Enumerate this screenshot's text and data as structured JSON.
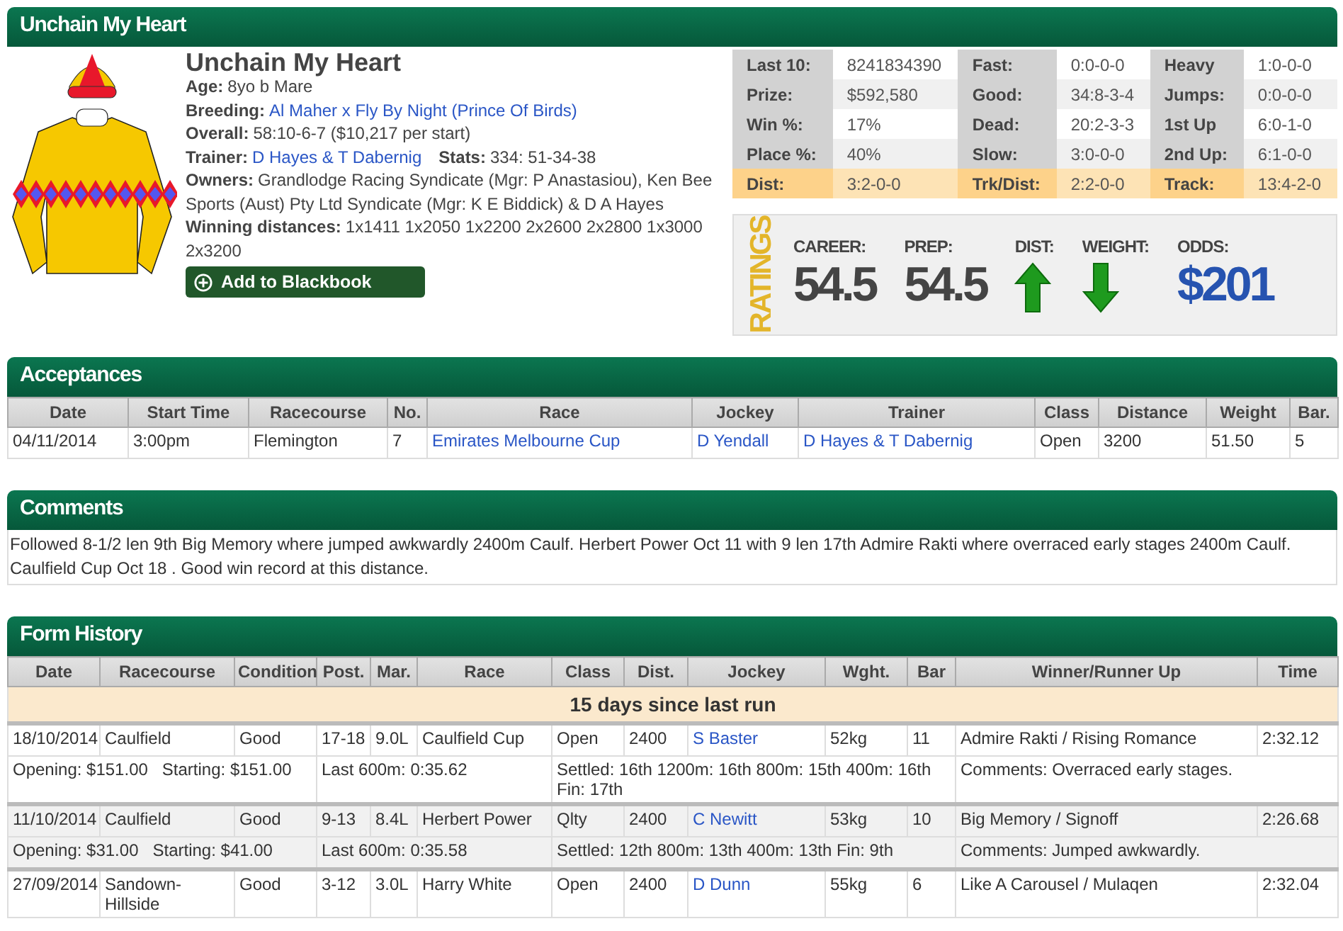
{
  "profile": {
    "title": "Unchain My Heart",
    "name": "Unchain My Heart",
    "info": [
      {
        "pairs": [
          {
            "label": "Age:",
            "value": "8yo b Mare",
            "link": false
          }
        ]
      },
      {
        "pairs": [
          {
            "label": "Breeding:",
            "value": "Al Maher x Fly By Night (Prince Of Birds)",
            "link": true
          }
        ]
      },
      {
        "pairs": [
          {
            "label": "Overall:",
            "value": "58:10-6-7 ($10,217 per start)",
            "link": false
          }
        ]
      },
      {
        "pairs": [
          {
            "label": "Trainer:",
            "value": "D Hayes & T Dabernig",
            "link": true
          },
          {
            "label": "Stats:",
            "value": "334: 51-34-38",
            "link": false
          }
        ]
      },
      {
        "pairs": [
          {
            "label": "Owners:",
            "value": "Grandlodge Racing Syndicate (Mgr: P Anastasiou), Ken Bee Sports (Aust) Pty Ltd Syndicate (Mgr: K E Biddick) & D A Hayes",
            "link": false
          }
        ]
      },
      {
        "pairs": [
          {
            "label": "Winning distances:",
            "value": "1x1411 1x2050 1x2200 2x2600 2x2800 1x3000 2x3200",
            "link": false
          }
        ]
      }
    ],
    "button": "Add to Blackbook",
    "stats": [
      {
        "highlight": false,
        "cells": [
          "Last 10:",
          "8241834390",
          "Fast:",
          "0:0-0-0",
          "Heavy",
          "1:0-0-0"
        ]
      },
      {
        "highlight": false,
        "cells": [
          "Prize:",
          "$592,580",
          "Good:",
          "34:8-3-4",
          "Jumps:",
          "0:0-0-0"
        ]
      },
      {
        "highlight": false,
        "cells": [
          "Win %:",
          "17%",
          "Dead:",
          "20:2-3-3",
          "1st Up",
          "6:0-1-0"
        ]
      },
      {
        "highlight": false,
        "cells": [
          "Place %:",
          "40%",
          "Slow:",
          "3:0-0-0",
          "2nd Up:",
          "6:1-0-0"
        ]
      },
      {
        "highlight": true,
        "cells": [
          "Dist:",
          "3:2-0-0",
          "Trk/Dist:",
          "2:2-0-0",
          "Track:",
          "13:4-2-0"
        ]
      }
    ],
    "ratings": {
      "title": "RATINGS",
      "items": [
        {
          "kind": "number",
          "label": "CAREER:",
          "value": "54.5"
        },
        {
          "kind": "number",
          "label": "PREP:",
          "value": "54.5"
        },
        {
          "kind": "up_arrow",
          "label": "DIST:"
        },
        {
          "kind": "down_arrow",
          "label": "WEIGHT:"
        },
        {
          "kind": "odds",
          "label": "ODDS:",
          "value": "$201"
        }
      ]
    }
  },
  "acceptances": {
    "title": "Acceptances",
    "columns": [
      {
        "label": "Date",
        "link": false
      },
      {
        "label": "Start Time",
        "link": false
      },
      {
        "label": "Racecourse",
        "link": false
      },
      {
        "label": "No.",
        "link": false
      },
      {
        "label": "Race",
        "link": true
      },
      {
        "label": "Jockey",
        "link": true
      },
      {
        "label": "Trainer",
        "link": true
      },
      {
        "label": "Class",
        "link": false
      },
      {
        "label": "Distance",
        "link": false
      },
      {
        "label": "Weight",
        "link": false
      },
      {
        "label": "Bar.",
        "link": false
      }
    ],
    "rows": [
      [
        "04/11/2014",
        "3:00pm",
        "Flemington",
        "7",
        "Emirates Melbourne Cup",
        "D Yendall",
        "D Hayes & T Dabernig",
        "Open",
        "3200",
        "51.50",
        "5"
      ]
    ]
  },
  "comments": {
    "title": "Comments",
    "text": "Followed 8-1/2 len 9th Big Memory where jumped awkwardly 2400m Caulf. Herbert Power Oct 11 with 9 len 17th Admire Rakti where overraced early stages 2400m Caulf. Caulfield Cup Oct 18 . Good win record at this distance."
  },
  "form_history": {
    "title": "Form History",
    "columns": [
      {
        "label": "Date",
        "link": false
      },
      {
        "label": "Racecourse",
        "link": false
      },
      {
        "label": "Condition",
        "link": false
      },
      {
        "label": "Post.",
        "link": false
      },
      {
        "label": "Mar.",
        "link": false
      },
      {
        "label": "Race",
        "link": false
      },
      {
        "label": "Class",
        "link": false
      },
      {
        "label": "Dist.",
        "link": false
      },
      {
        "label": "Jockey",
        "link": true
      },
      {
        "label": "Wght.",
        "link": false
      },
      {
        "label": "Bar",
        "link": false
      },
      {
        "label": "Winner/Runner Up",
        "link": false
      },
      {
        "label": "Time",
        "link": false
      }
    ],
    "banner": "15 days since last run",
    "runs": [
      {
        "cells": [
          "18/10/2014",
          "Caulfield",
          "Good",
          "17-18",
          "9.0L",
          "Caulfield Cup",
          "Open",
          "2400",
          "S Baster",
          "52kg",
          "11",
          "Admire Rakti / Rising Romance",
          "2:32.12"
        ],
        "details": [
          "Opening: $151.00   Starting: $151.00",
          "Last 600m: 0:35.62",
          "Settled: 16th 1200m: 16th 800m: 15th 400m: 16th Fin: 17th",
          "Comments: Overraced early stages."
        ]
      },
      {
        "cells": [
          "11/10/2014",
          "Caulfield",
          "Good",
          "9-13",
          "8.4L",
          "Herbert Power",
          "Qlty",
          "2400",
          "C Newitt",
          "53kg",
          "10",
          "Big Memory / Signoff",
          "2:26.68"
        ],
        "details": [
          "Opening: $31.00   Starting: $41.00",
          "Last 600m: 0:35.58",
          "Settled: 12th 800m: 13th 400m: 13th Fin: 9th",
          "Comments: Jumped awkwardly."
        ]
      },
      {
        "cells": [
          "27/09/2014",
          "Sandown-Hillside",
          "Good",
          "3-12",
          "3.0L",
          "Harry White",
          "Open",
          "2400",
          "D Dunn",
          "55kg",
          "6",
          "Like A Carousel / Mulaqen",
          "2:32.04"
        ]
      }
    ]
  }
}
